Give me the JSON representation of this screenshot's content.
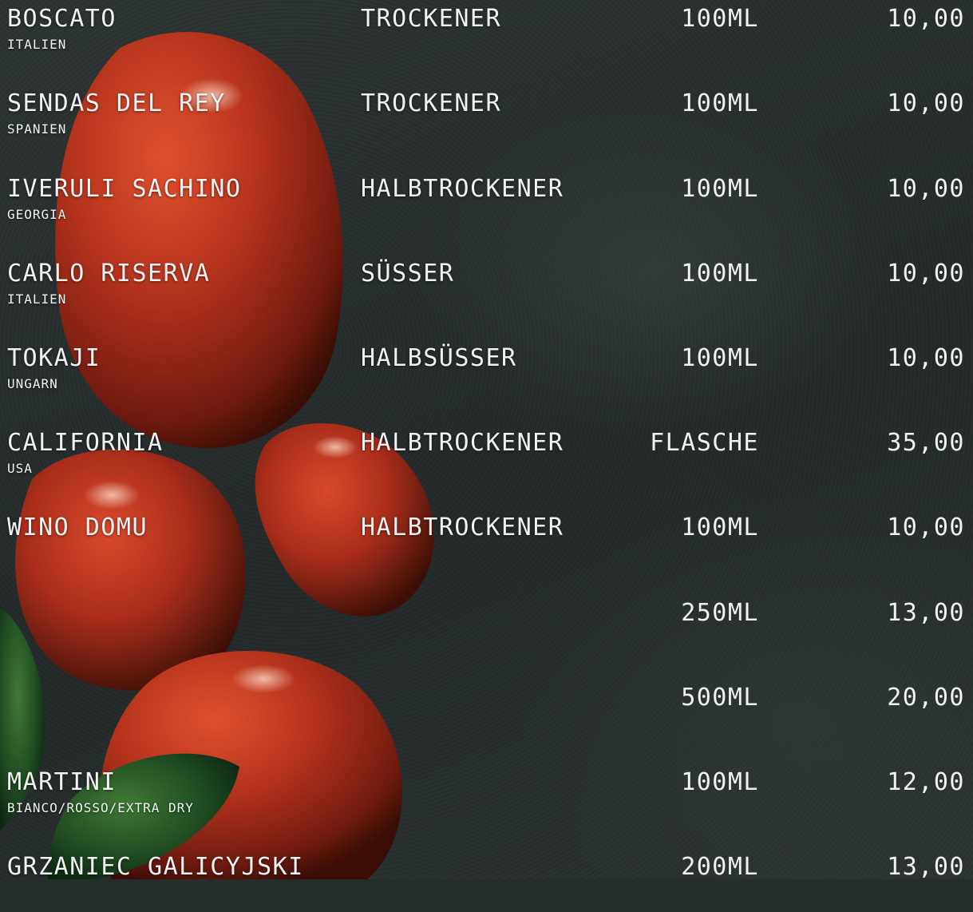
{
  "items": [
    {
      "name": "BOSCATO",
      "origin": "ITALIEN",
      "type": "TROCKENER",
      "size": "100ML",
      "price": "10,00"
    },
    {
      "name": "SENDAS DEL REY",
      "origin": "SPANIEN",
      "type": "TROCKENER",
      "size": "100ML",
      "price": "10,00"
    },
    {
      "name": "IVERULI SACHINO",
      "origin": "GEORGIA",
      "type": "HALBTROCKENER",
      "size": "100ML",
      "price": "10,00"
    },
    {
      "name": "CARLO RISERVA",
      "origin": "ITALIEN",
      "type": "SÜSSER",
      "size": "100ML",
      "price": "10,00"
    },
    {
      "name": "TOKAJI",
      "origin": "UNGARN",
      "type": "HALBSÜSSER",
      "size": "100ML",
      "price": "10,00"
    },
    {
      "name": "CALIFORNIA",
      "origin": "USA",
      "type": "HALBTROCKENER",
      "size": "FLASCHE",
      "price": "35,00"
    },
    {
      "name": "WINO DOMU",
      "origin": "",
      "type": "HALBTROCKENER",
      "size": "100ML",
      "price": "10,00"
    },
    {
      "name": "",
      "origin": "",
      "type": "",
      "size": "250ML",
      "price": "13,00"
    },
    {
      "name": "",
      "origin": "",
      "type": "",
      "size": "500ML",
      "price": "20,00"
    },
    {
      "name": "MARTINI",
      "origin": "BIANCO/ROSSO/EXTRA DRY",
      "type": "",
      "size": "100ML",
      "price": "12,00"
    },
    {
      "name": "GRZANIEC GALICYJSKI",
      "origin": "",
      "type": "",
      "size": "200ML",
      "price": "13,00"
    }
  ],
  "colors": {
    "text": "#f2f2f2",
    "slate": "#262d2d",
    "tomato": "#b7301c",
    "basil": "#1f4a22"
  }
}
